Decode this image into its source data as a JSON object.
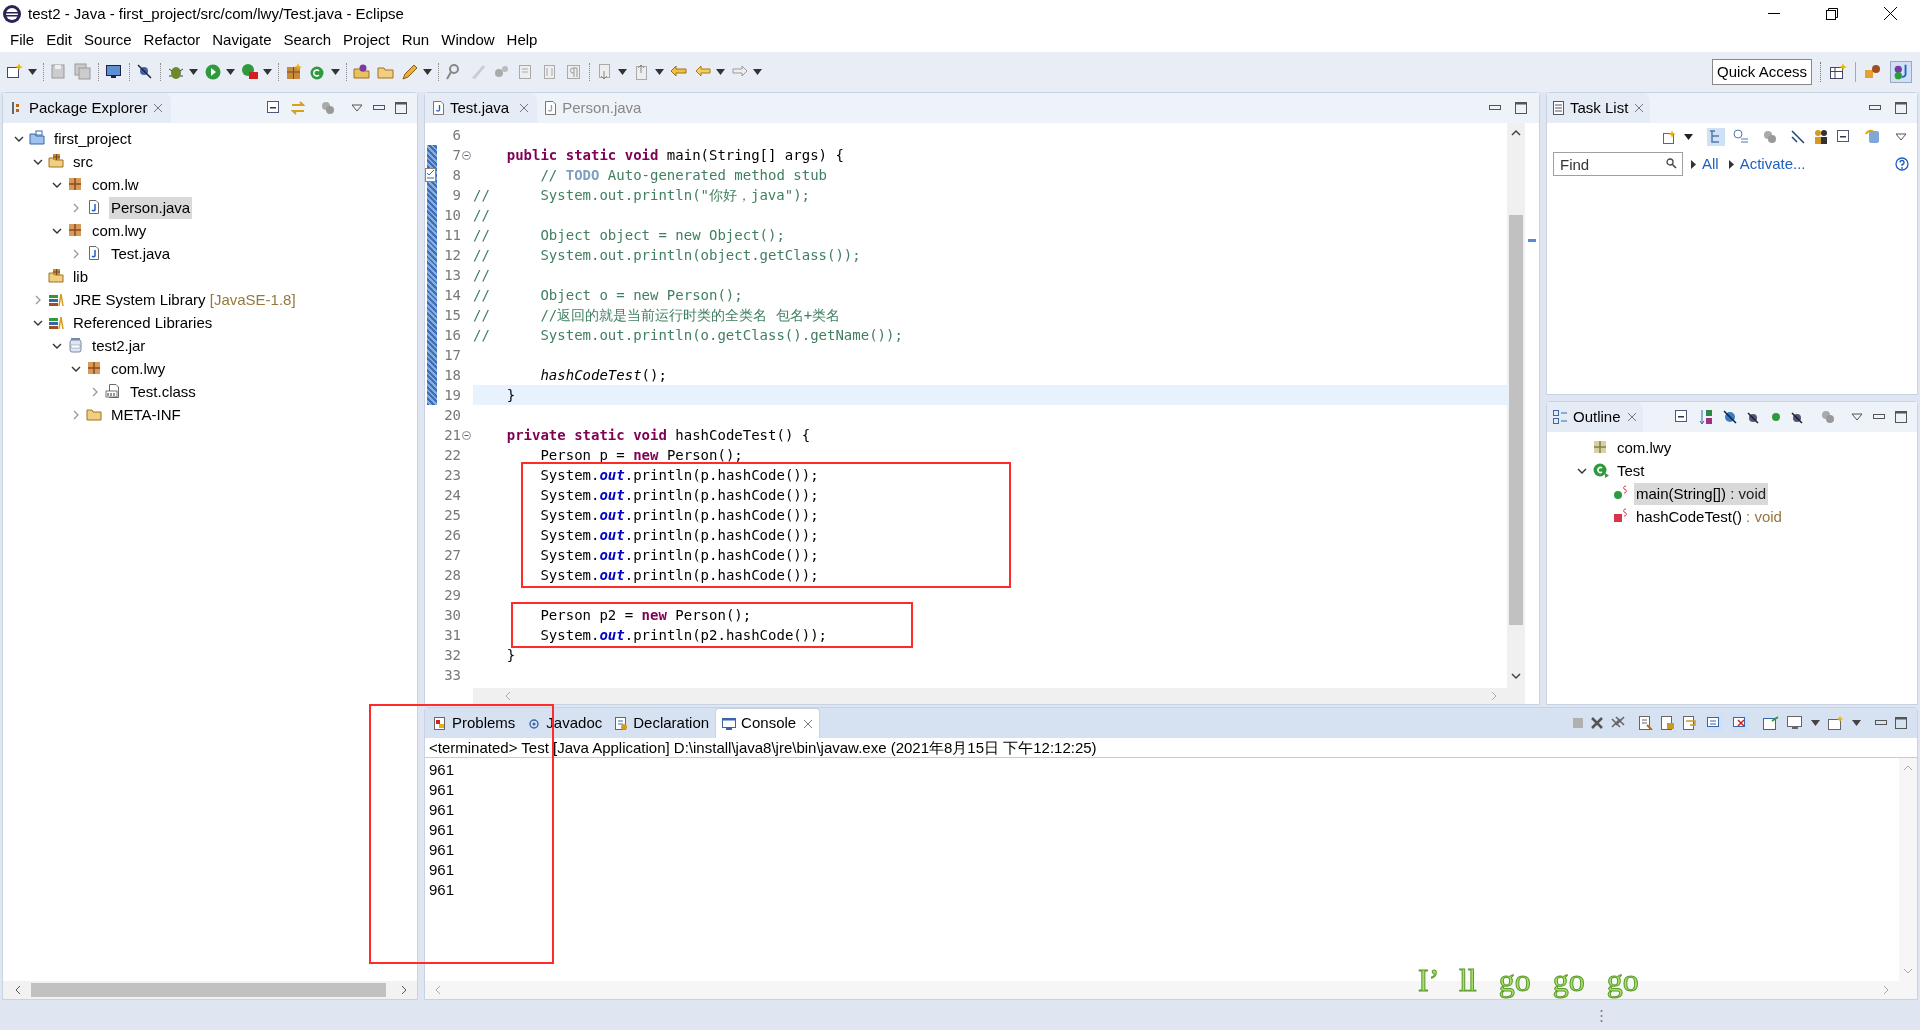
{
  "window": {
    "title": "test2 - Java - first_project/src/com/lwy/Test.java - Eclipse"
  },
  "menu": [
    "File",
    "Edit",
    "Source",
    "Refactor",
    "Navigate",
    "Search",
    "Project",
    "Run",
    "Window",
    "Help"
  ],
  "toolbar": {
    "quick_access": "Quick Access"
  },
  "package_explorer": {
    "title": "Package Explorer",
    "tree": [
      {
        "label": "first_project",
        "kind": "project",
        "expanded": true,
        "selected": false,
        "children": [
          {
            "label": "src",
            "kind": "src",
            "expanded": true,
            "selected": false,
            "children": [
              {
                "label": "com.lw",
                "kind": "package",
                "expanded": true,
                "selected": false,
                "children": [
                  {
                    "label": "Person.java",
                    "kind": "java",
                    "expanded": false,
                    "selected": true
                  }
                ]
              },
              {
                "label": "com.lwy",
                "kind": "package",
                "expanded": true,
                "selected": false,
                "children": [
                  {
                    "label": "Test.java",
                    "kind": "java",
                    "expanded": false,
                    "selected": false
                  }
                ]
              }
            ]
          },
          {
            "label": "lib",
            "kind": "libfolder",
            "selected": false
          },
          {
            "label": "JRE System Library",
            "decoration": "[JavaSE-1.8]",
            "kind": "library",
            "expanded": false,
            "selected": false
          },
          {
            "label": "Referenced Libraries",
            "kind": "library",
            "expanded": true,
            "selected": false,
            "children": [
              {
                "label": "test2.jar",
                "kind": "jar",
                "expanded": true,
                "selected": false,
                "children": [
                  {
                    "label": "com.lwy",
                    "kind": "package",
                    "expanded": true,
                    "selected": false,
                    "children": [
                      {
                        "label": "Test.class",
                        "kind": "class",
                        "expanded": false,
                        "selected": false
                      }
                    ]
                  },
                  {
                    "label": "META-INF",
                    "kind": "folder",
                    "expanded": false,
                    "selected": false
                  }
                ]
              }
            ]
          }
        ]
      }
    ]
  },
  "editor": {
    "tabs": [
      {
        "label": "Test.java",
        "selected": true
      },
      {
        "label": "Person.java",
        "selected": false
      }
    ],
    "lines": [
      {
        "n": "6"
      },
      {
        "n": "7",
        "fold": true,
        "tokens": [
          {
            "kind": "kw",
            "text": "    public static void"
          },
          {
            "kind": "plain",
            "text": " main(String[] args) {"
          }
        ]
      },
      {
        "n": "8",
        "task": true,
        "tokens": [
          {
            "kind": "comment",
            "text": "        // "
          },
          {
            "kind": "todo",
            "text": "TODO"
          },
          {
            "kind": "comment",
            "text": " Auto-generated method stub"
          }
        ]
      },
      {
        "n": "9",
        "tokens": [
          {
            "kind": "comment",
            "text": "//      System.out.println(\"你好，java\");"
          }
        ]
      },
      {
        "n": "10",
        "tokens": [
          {
            "kind": "comment",
            "text": "//"
          }
        ]
      },
      {
        "n": "11",
        "tokens": [
          {
            "kind": "comment",
            "text": "//      Object object = new Object();"
          }
        ]
      },
      {
        "n": "12",
        "tokens": [
          {
            "kind": "comment",
            "text": "//      System.out.println(object.getClass());"
          }
        ]
      },
      {
        "n": "13",
        "tokens": [
          {
            "kind": "comment",
            "text": "//"
          }
        ]
      },
      {
        "n": "14",
        "tokens": [
          {
            "kind": "comment",
            "text": "//      Object o = new Person();"
          }
        ]
      },
      {
        "n": "15",
        "tokens": [
          {
            "kind": "comment",
            "text": "//      //返回的就是当前运行时类的全类名 包名+类名"
          }
        ]
      },
      {
        "n": "16",
        "tokens": [
          {
            "kind": "comment",
            "text": "//      System.out.println(o.getClass().getName());"
          }
        ]
      },
      {
        "n": "17"
      },
      {
        "n": "18",
        "tokens": [
          {
            "kind": "call",
            "text": "        hashCodeTest"
          },
          {
            "kind": "plain",
            "text": "();"
          }
        ]
      },
      {
        "n": "19",
        "current": true,
        "tokens": [
          {
            "kind": "plain",
            "text": "    }"
          }
        ]
      },
      {
        "n": "20"
      },
      {
        "n": "21",
        "fold": true,
        "tokens": [
          {
            "kind": "kw",
            "text": "    private static void"
          },
          {
            "kind": "plain",
            "text": " hashCodeTest() {"
          }
        ]
      },
      {
        "n": "22",
        "tokens": [
          {
            "kind": "plain",
            "text": "        Person p = "
          },
          {
            "kind": "kw",
            "text": "new"
          },
          {
            "kind": "plain",
            "text": " Person();"
          }
        ]
      },
      {
        "n": "23",
        "boxed": true,
        "tokens": [
          {
            "kind": "plain",
            "text": "        System."
          },
          {
            "kind": "field",
            "text": "out"
          },
          {
            "kind": "plain",
            "text": ".println(p.hashCode());"
          }
        ]
      },
      {
        "n": "24",
        "boxed": true,
        "tokens": [
          {
            "kind": "plain",
            "text": "        System."
          },
          {
            "kind": "field",
            "text": "out"
          },
          {
            "kind": "plain",
            "text": ".println(p.hashCode());"
          }
        ]
      },
      {
        "n": "25",
        "boxed": true,
        "tokens": [
          {
            "kind": "plain",
            "text": "        System."
          },
          {
            "kind": "field",
            "text": "out"
          },
          {
            "kind": "plain",
            "text": ".println(p.hashCode());"
          }
        ]
      },
      {
        "n": "26",
        "boxed": true,
        "tokens": [
          {
            "kind": "plain",
            "text": "        System."
          },
          {
            "kind": "field",
            "text": "out"
          },
          {
            "kind": "plain",
            "text": ".println(p.hashCode());"
          }
        ]
      },
      {
        "n": "27",
        "boxed": true,
        "tokens": [
          {
            "kind": "plain",
            "text": "        System."
          },
          {
            "kind": "field",
            "text": "out"
          },
          {
            "kind": "plain",
            "text": ".println(p.hashCode());"
          }
        ]
      },
      {
        "n": "28",
        "boxed": true,
        "tokens": [
          {
            "kind": "plain",
            "text": "        System."
          },
          {
            "kind": "field",
            "text": "out"
          },
          {
            "kind": "plain",
            "text": ".println(p.hashCode());"
          }
        ]
      },
      {
        "n": "29"
      },
      {
        "n": "30",
        "boxed": true,
        "tokens": [
          {
            "kind": "plain",
            "text": "        Person p2 = "
          },
          {
            "kind": "kw",
            "text": "new"
          },
          {
            "kind": "plain",
            "text": " Person();"
          }
        ]
      },
      {
        "n": "31",
        "boxed": true,
        "tokens": [
          {
            "kind": "plain",
            "text": "        System."
          },
          {
            "kind": "field",
            "text": "out"
          },
          {
            "kind": "plain",
            "text": ".println(p2.hashCode());"
          }
        ]
      },
      {
        "n": "32",
        "tokens": [
          {
            "kind": "plain",
            "text": "    }"
          }
        ]
      },
      {
        "n": "33"
      }
    ]
  },
  "task_list": {
    "title": "Task List",
    "find_placeholder": "Find",
    "links": [
      "All",
      "Activate..."
    ]
  },
  "outline": {
    "title": "Outline",
    "tree": [
      {
        "label": "com.lwy",
        "kind": "package",
        "selected": false
      },
      {
        "label": "Test",
        "kind": "class",
        "expanded": true,
        "selected": false,
        "children": [
          {
            "label": "main(String[])",
            "detail": " : void",
            "kind": "public-method",
            "selected": true
          },
          {
            "label": "hashCodeTest()",
            "detail": " : void",
            "kind": "private-method",
            "selected": false
          }
        ]
      }
    ]
  },
  "console": {
    "tabs": [
      {
        "label": "Problems",
        "kind": "problems",
        "selected": false
      },
      {
        "label": "Javadoc",
        "kind": "javadoc",
        "selected": false
      },
      {
        "label": "Declaration",
        "kind": "declaration",
        "selected": false
      },
      {
        "label": "Console",
        "kind": "console",
        "selected": true
      }
    ],
    "header": "<terminated> Test [Java Application] D:\\install\\java8\\jre\\bin\\javaw.exe (2021年8月15日 下午12:12:25)",
    "output": [
      "961",
      "961",
      "961",
      "961",
      "961",
      "961",
      "961"
    ],
    "annotated": true
  },
  "overlay_text": "I’ ll go go go"
}
